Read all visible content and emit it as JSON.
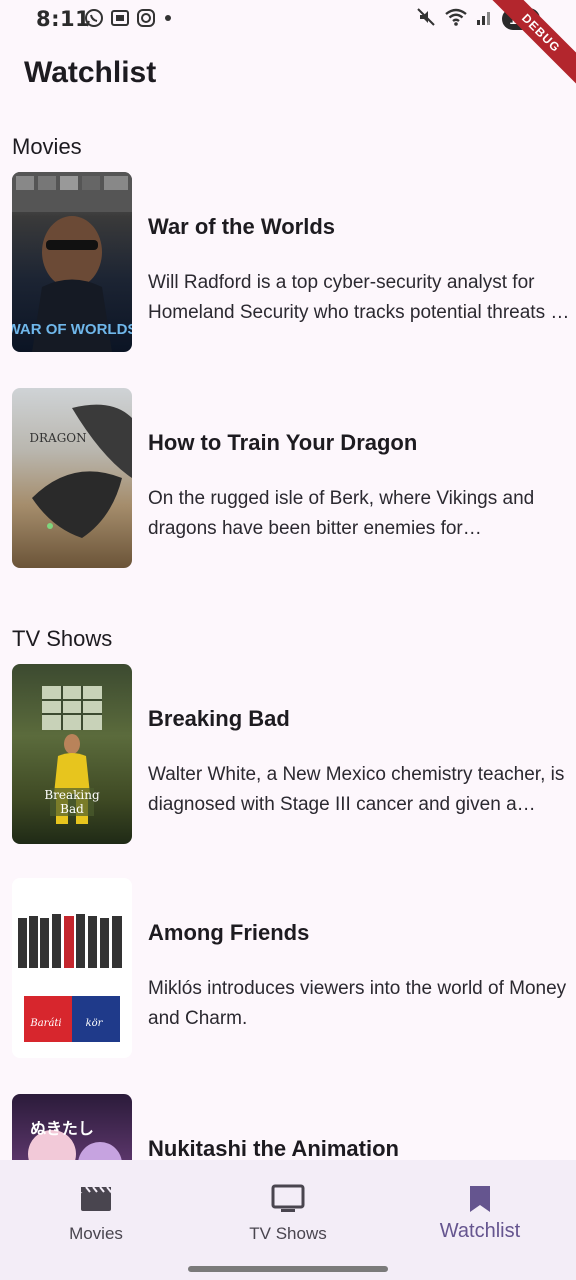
{
  "status_bar": {
    "time": "8:11",
    "battery": "100",
    "debug_label": "DEBUG",
    "left_icons": [
      "whatsapp-icon",
      "screenshot-icon",
      "instagram-icon",
      "dot-icon"
    ],
    "right_icons": [
      "mute-icon",
      "wifi-icon",
      "signal-icon",
      "battery-icon"
    ]
  },
  "app_bar": {
    "title": "Watchlist"
  },
  "sections": {
    "movies": {
      "header": "Movies",
      "items": [
        {
          "title": "War of the Worlds",
          "description": "Will Radford is a top cyber-security analyst for Homeland Security who tracks potential threats to national security through a mass surveillance program.",
          "poster_text": "WAR OF THE WORLDS"
        },
        {
          "title": "How to Train Your Dragon",
          "description": "On the rugged isle of Berk, where Vikings and dragons have been bitter enemies for generations.",
          "poster_text": "DRAGON"
        }
      ]
    },
    "tv_shows": {
      "header": "TV Shows",
      "items": [
        {
          "title": "Breaking Bad",
          "description": "Walter White, a New Mexico chemistry teacher, is diagnosed with Stage III cancer and given a prognosis of only two years left to live.",
          "poster_text": "Breaking Bad"
        },
        {
          "title": "Among Friends",
          "description": "Miklós introduces viewers into the world of Money and Charm.",
          "poster_text": "Baráti kör"
        },
        {
          "title": "Nukitashi the Animation",
          "description": "",
          "poster_text": "ぬきたし"
        }
      ]
    }
  },
  "bottom_nav": {
    "items": [
      {
        "label": "Movies",
        "icon": "movie-clapper-icon",
        "active": false
      },
      {
        "label": "TV Shows",
        "icon": "tv-icon",
        "active": false
      },
      {
        "label": "Watchlist",
        "icon": "bookmark-icon",
        "active": true
      }
    ]
  },
  "colors": {
    "background": "#fdf7fc",
    "nav_background": "#f3edf7",
    "active": "#65558f",
    "inactive": "#49454f",
    "text": "#1d1b20"
  }
}
